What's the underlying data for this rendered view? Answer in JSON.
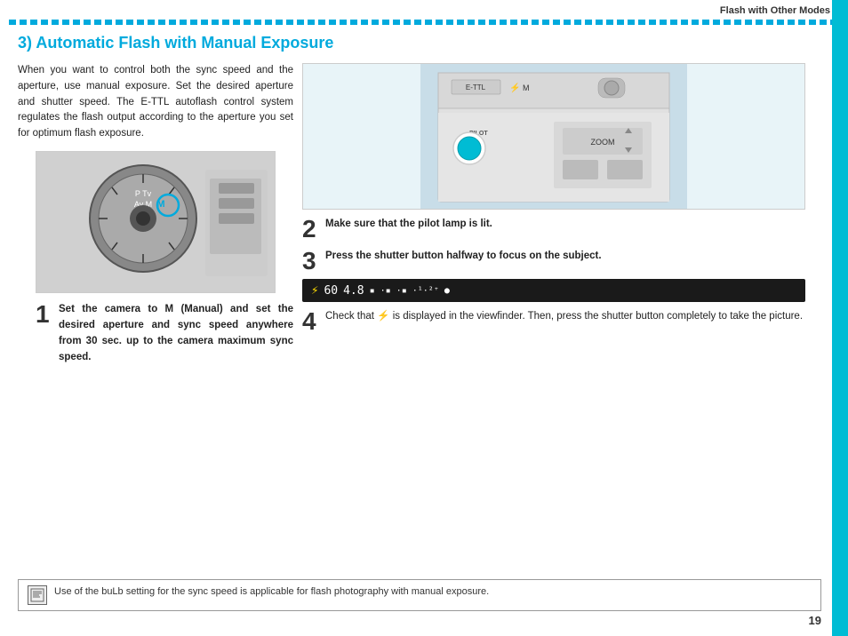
{
  "header": {
    "title": "Flash with Other Modes"
  },
  "section": {
    "heading": "3) Automatic Flash with Manual Exposure"
  },
  "intro": {
    "text": "When you want to control both the sync speed and the aperture, use manual exposure. Set the desired aperture and shutter speed. The E-TTL autoflash control system regulates the flash output according to the aperture you set for optimum flash exposure."
  },
  "steps": [
    {
      "number": "1",
      "text": "Set the camera to M (Manual) and set the desired aperture and sync speed anywhere from 30 sec. up to the camera maximum sync speed."
    },
    {
      "number": "2",
      "text": "Make sure that the pilot lamp is lit."
    },
    {
      "number": "3",
      "text": "Press the shutter button halfway to focus on the subject."
    },
    {
      "number": "4",
      "text": "Check that ⚡ is displayed in the viewfinder. Then, press the shutter button completely to take the picture."
    }
  ],
  "viewfinder": {
    "icon": "⚡",
    "shutter": "60",
    "aperture": "4.8",
    "exposure_bar": "▪·▪·▪"
  },
  "note": {
    "text": "Use of the buLb setting for the sync speed is applicable for flash photography with manual exposure."
  },
  "page": {
    "number": "19"
  }
}
